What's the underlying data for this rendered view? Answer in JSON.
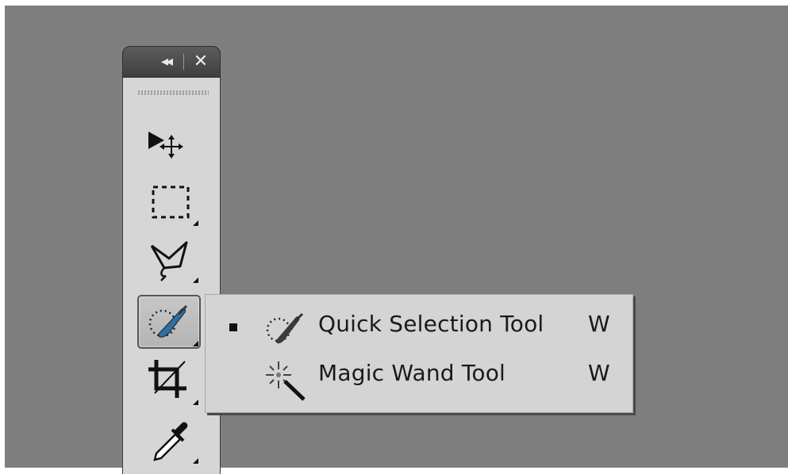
{
  "panel": {
    "collapse_glyph": "◂◂",
    "close_glyph": "✕",
    "tools": [
      {
        "name": "move-tool",
        "icon": "move-icon",
        "active": false
      },
      {
        "name": "rectangular-marquee-tool",
        "icon": "marquee-icon",
        "active": false
      },
      {
        "name": "lasso-tool",
        "icon": "polygonal-lasso-icon",
        "active": false
      },
      {
        "name": "quick-selection-tool",
        "icon": "quick-selection-icon",
        "active": true
      },
      {
        "name": "crop-tool",
        "icon": "crop-icon",
        "active": false
      },
      {
        "name": "eyedropper-tool",
        "icon": "eyedropper-icon",
        "active": false
      }
    ]
  },
  "flyout": {
    "items": [
      {
        "label": "Quick Selection Tool",
        "shortcut": "W",
        "selected": true,
        "icon": "quick-selection-icon"
      },
      {
        "label": "Magic Wand Tool",
        "shortcut": "W",
        "selected": false,
        "icon": "magic-wand-icon"
      }
    ]
  },
  "colors": {
    "canvas": "#7e7e7e",
    "panel": "#d6d6d6",
    "header": "#4a4a4a",
    "brush_accent": "#2f6e9e"
  }
}
